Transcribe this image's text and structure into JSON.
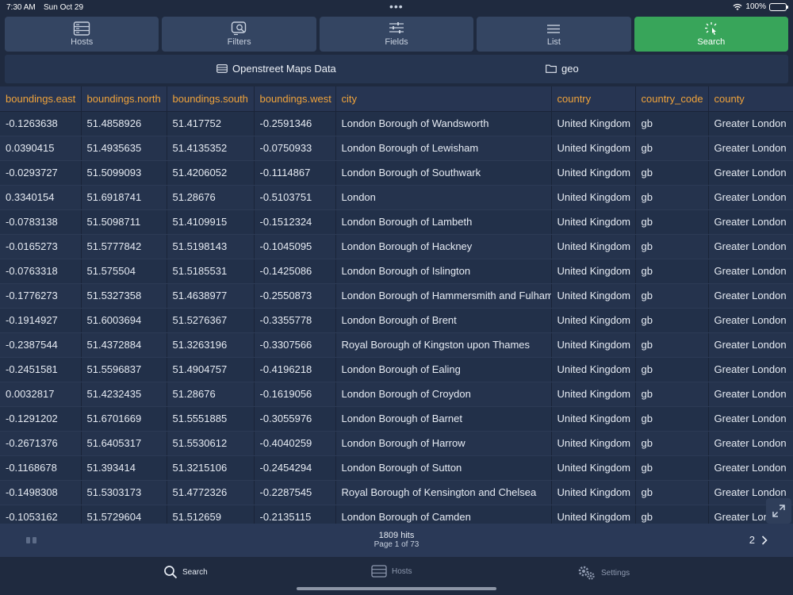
{
  "status": {
    "time": "7:30 AM",
    "date": "Sun Oct 29",
    "battery": "100%"
  },
  "toolbar": {
    "hosts": "Hosts",
    "filters": "Filters",
    "fields": "Fields",
    "list": "List",
    "search": "Search",
    "active_color": "#38a55a"
  },
  "source": {
    "index_name": "Openstreet Maps Data",
    "folder": "geo"
  },
  "table": {
    "headers": [
      "boundings.east",
      "boundings.north",
      "boundings.south",
      "boundings.west",
      "city",
      "country",
      "country_code",
      "county"
    ],
    "rows": [
      [
        "-0.1263638",
        "51.4858926",
        "51.417752",
        "-0.2591346",
        "London Borough of Wandsworth",
        "United Kingdom",
        "gb",
        "Greater London"
      ],
      [
        "0.0390415",
        "51.4935635",
        "51.4135352",
        "-0.0750933",
        "London Borough of Lewisham",
        "United Kingdom",
        "gb",
        "Greater London"
      ],
      [
        "-0.0293727",
        "51.5099093",
        "51.4206052",
        "-0.1114867",
        "London Borough of Southwark",
        "United Kingdom",
        "gb",
        "Greater London"
      ],
      [
        "0.3340154",
        "51.6918741",
        "51.28676",
        "-0.5103751",
        "London",
        "United Kingdom",
        "gb",
        "Greater London"
      ],
      [
        "-0.0783138",
        "51.5098711",
        "51.4109915",
        "-0.1512324",
        "London Borough of Lambeth",
        "United Kingdom",
        "gb",
        "Greater London"
      ],
      [
        "-0.0165273",
        "51.5777842",
        "51.5198143",
        "-0.1045095",
        "London Borough of Hackney",
        "United Kingdom",
        "gb",
        "Greater London"
      ],
      [
        "-0.0763318",
        "51.575504",
        "51.5185531",
        "-0.1425086",
        "London Borough of Islington",
        "United Kingdom",
        "gb",
        "Greater London"
      ],
      [
        "-0.1776273",
        "51.5327358",
        "51.4638977",
        "-0.2550873",
        "London Borough of Hammersmith and Fulham",
        "United Kingdom",
        "gb",
        "Greater London"
      ],
      [
        "-0.1914927",
        "51.6003694",
        "51.5276367",
        "-0.3355778",
        "London Borough of Brent",
        "United Kingdom",
        "gb",
        "Greater London"
      ],
      [
        "-0.2387544",
        "51.4372884",
        "51.3263196",
        "-0.3307566",
        "Royal Borough of Kingston upon Thames",
        "United Kingdom",
        "gb",
        "Greater London"
      ],
      [
        "-0.2451581",
        "51.5596837",
        "51.4904757",
        "-0.4196218",
        "London Borough of Ealing",
        "United Kingdom",
        "gb",
        "Greater London"
      ],
      [
        "0.0032817",
        "51.4232435",
        "51.28676",
        "-0.1619056",
        "London Borough of Croydon",
        "United Kingdom",
        "gb",
        "Greater London"
      ],
      [
        "-0.1291202",
        "51.6701669",
        "51.5551885",
        "-0.3055976",
        "London Borough of Barnet",
        "United Kingdom",
        "gb",
        "Greater London"
      ],
      [
        "-0.2671376",
        "51.6405317",
        "51.5530612",
        "-0.4040259",
        "London Borough of Harrow",
        "United Kingdom",
        "gb",
        "Greater London"
      ],
      [
        "-0.1168678",
        "51.393414",
        "51.3215106",
        "-0.2454294",
        "London Borough of Sutton",
        "United Kingdom",
        "gb",
        "Greater London"
      ],
      [
        "-0.1498308",
        "51.5303173",
        "51.4772326",
        "-0.2287545",
        "Royal Borough of Kensington and Chelsea",
        "United Kingdom",
        "gb",
        "Greater London"
      ],
      [
        "-0.1053162",
        "51.5729604",
        "51.512659",
        "-0.2135115",
        "London Borough of Camden",
        "United Kingdom",
        "gb",
        "Greater London"
      ]
    ]
  },
  "pager": {
    "hits": "1809 hits",
    "page": "Page 1 of 73",
    "next_page": "2"
  },
  "tabbar": {
    "search": "Search",
    "hosts": "Hosts",
    "settings": "Settings"
  },
  "colors": {
    "header_text": "#f0a33b",
    "background": "#1f2a3f"
  }
}
